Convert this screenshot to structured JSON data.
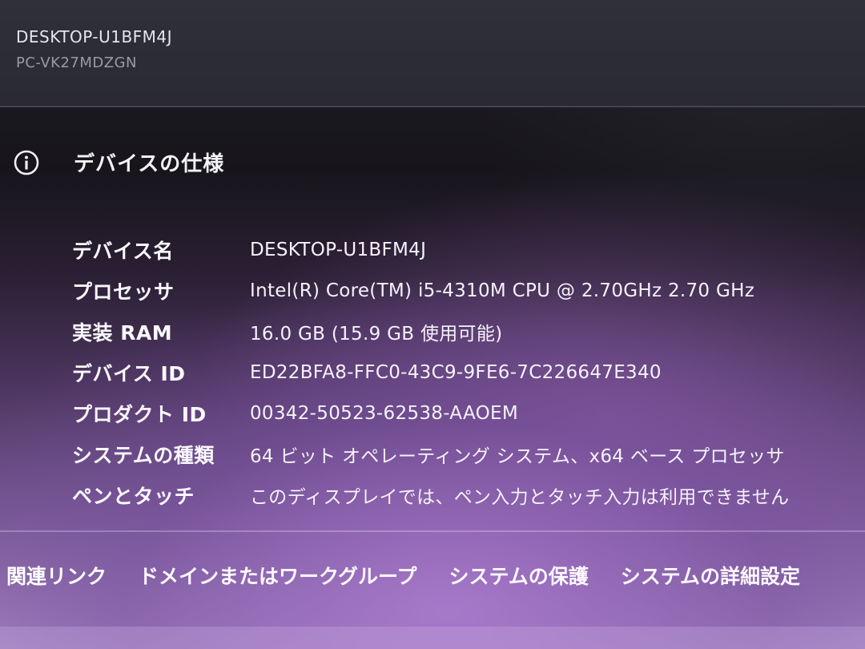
{
  "header": {
    "pc_name": "DESKTOP-U1BFM4J",
    "pc_model": "PC-VK27MDZGN"
  },
  "device_specs": {
    "title": "デバイスの仕様",
    "icon": "info-icon",
    "rows": [
      {
        "label": "デバイス名",
        "value": "DESKTOP-U1BFM4J"
      },
      {
        "label": "プロセッサ",
        "value": "Intel(R) Core(TM) i5-4310M CPU @ 2.70GHz   2.70 GHz"
      },
      {
        "label": "実装 RAM",
        "value": "16.0 GB (15.9 GB 使用可能)"
      },
      {
        "label": "デバイス ID",
        "value": "ED22BFA8-FFC0-43C9-9FE6-7C226647E340"
      },
      {
        "label": "プロダクト ID",
        "value": "00342-50523-62538-AAOEM"
      },
      {
        "label": "システムの種類",
        "value": "64 ビット オペレーティング システム、x64 ベース プロセッサ"
      },
      {
        "label": "ペンとタッチ",
        "value": "このディスプレイでは、ペン入力とタッチ入力は利用できません"
      }
    ]
  },
  "related_links": {
    "heading": "関連リンク",
    "links": [
      "ドメインまたはワークグループ",
      "システムの保護",
      "システムの詳細設定"
    ]
  },
  "colors": {
    "header_bg": "#2a2a31",
    "accent_purple": "#a888c4"
  }
}
